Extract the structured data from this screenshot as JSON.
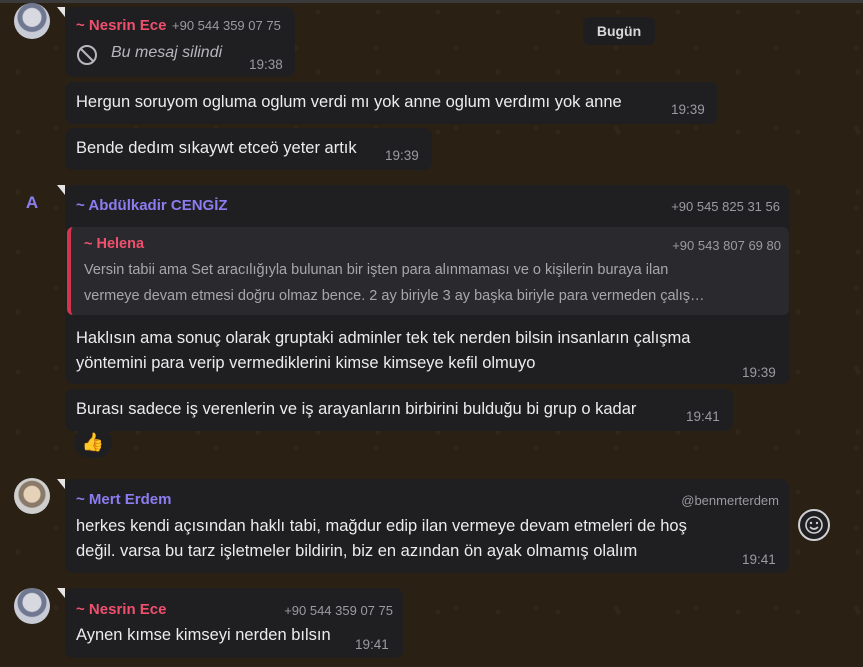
{
  "day_chip": "Bugün",
  "messages": [
    {
      "sender": "~ Nesrin Ece",
      "phone": "+90 544 359 07 75",
      "deleted_text": "Bu mesaj silindi",
      "time": "19:38"
    },
    {
      "text": "Hergun soruyom ogluma oglum verdi mı yok anne oglum verdımı yok anne",
      "time": "19:39"
    },
    {
      "text": "Bende dedım sıkaywt etceö yeter artık",
      "time": "19:39"
    },
    {
      "avatar_letter": "A",
      "sender": "~ Abdülkadir CENGİZ",
      "phone": "+90 545 825 31 56",
      "quote": {
        "sender": "~ Helena",
        "phone": "+90 543 807 69 80",
        "line1": "Versin tabii ama Set aracılığıyla bulunan bir işten para alınmaması ve o kişilerin buraya ilan",
        "line2": "vermeye devam etmesi doğru olmaz bence. 2 ay biriyle 3 ay başka biriyle para vermeden çalış…"
      },
      "line1": "Haklısın ama sonuç olarak gruptaki adminler tek tek nerden bilsin insanların çalışma",
      "line2": "yöntemini para verip vermediklerini kimse kimseye kefil olmuyo",
      "time": "19:39"
    },
    {
      "text": "Burası sadece iş verenlerin ve iş arayanların birbirini bulduğu bi grup o kadar",
      "time": "19:41",
      "reaction": "👍"
    },
    {
      "sender": "~ Mert Erdem",
      "handle": "@benmerterdem",
      "line1": "herkes kendi açısından haklı tabi, mağdur edip ilan vermeye devam etmeleri de hoş",
      "line2": "değil. varsa bu tarz işletmeler bildirin, biz en azından ön ayak olmamış olalım",
      "time": "19:41"
    },
    {
      "sender": "~ Nesrin Ece",
      "phone": "+90 544 359 07 75",
      "text": "Aynen kımse kimseyi nerden bılsın",
      "time": "19:41"
    }
  ],
  "icons": {
    "deleted": "no-entry-icon",
    "emoji": "smiley-icon"
  },
  "colors": {
    "background": "#2a2114",
    "bubble": "#1f1f22",
    "sender_pink": "#f0506e",
    "sender_purple": "#8c7cf0",
    "quote_bar": "#d2364f"
  }
}
